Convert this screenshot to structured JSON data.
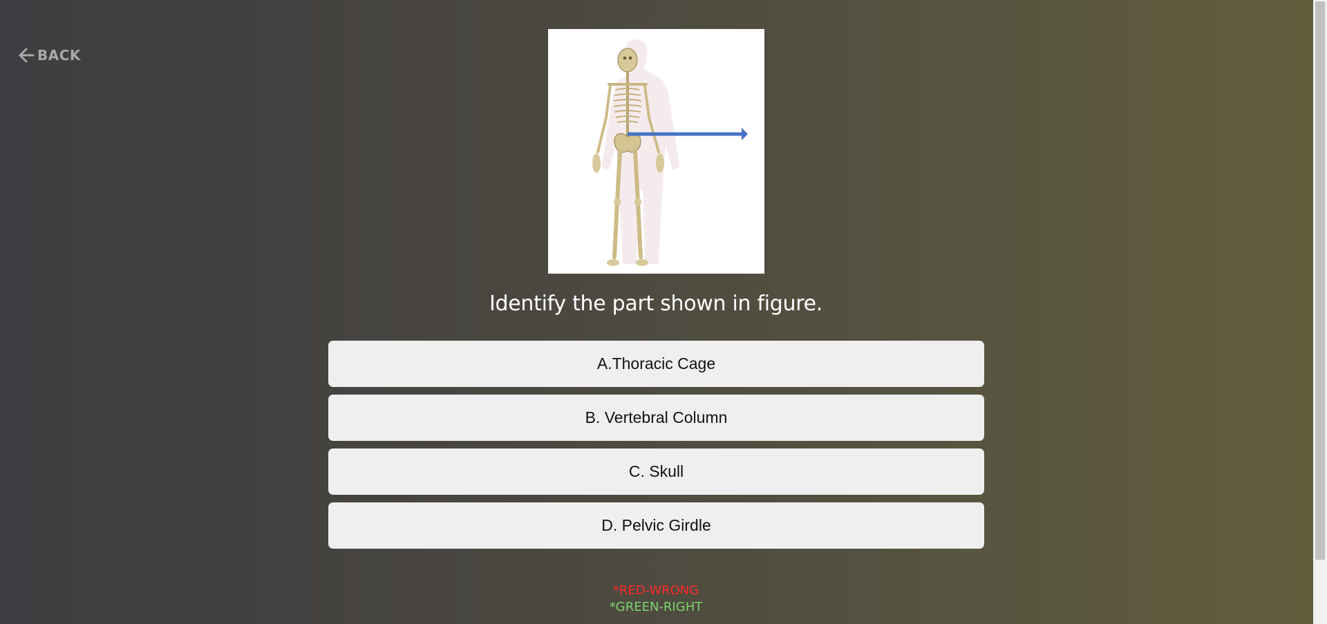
{
  "nav": {
    "back_label": "BACK",
    "back_icon": "arrow-left-icon"
  },
  "figure": {
    "subject": "human-skeleton",
    "arrow_color": "#4472c4"
  },
  "question": {
    "text": "Identify the part shown in figure."
  },
  "options": [
    {
      "label": "A.Thoracic Cage"
    },
    {
      "label": "B. Vertebral Column"
    },
    {
      "label": "C. Skull"
    },
    {
      "label": "D. Pelvic Girdle"
    }
  ],
  "legend": {
    "wrong_text": "*RED-WRONG",
    "wrong_color": "#ff2a2a",
    "right_text": "*GREEN-RIGHT",
    "right_color": "#7cd46a"
  }
}
